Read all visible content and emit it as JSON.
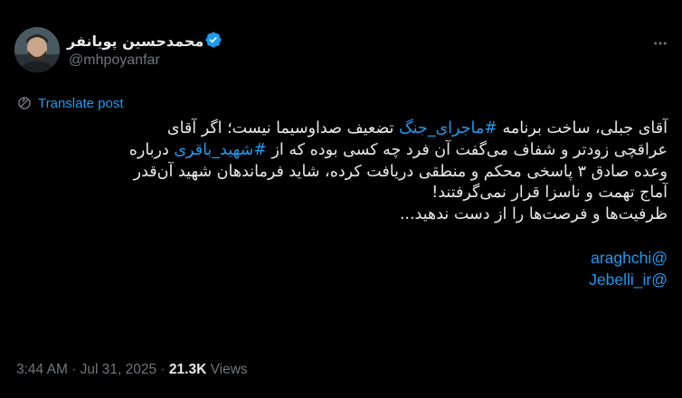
{
  "author": {
    "display_name": "محمدحسین پویانفر",
    "handle": "@mhpoyanfar",
    "verified_icon": "verified-badge-icon",
    "avatar_icon": "avatar"
  },
  "header": {
    "more_icon": "more-dots-icon"
  },
  "translate": {
    "label": "Translate post",
    "icon": "translate-icon"
  },
  "tweet": {
    "line1_before": "آقای جبلی، ساخت برنامه ",
    "hashtag1": "#ماجرای_جنگ",
    "line1_after": " تضعیف صداوسیما نیست؛ اگر آقای",
    "line2_before": "عراقچی زودتر و شفاف می‌گفت آن فرد چه کسی بوده که از ",
    "hashtag2": "#شهید_باقری",
    "line2_after": " درباره",
    "line3": "وعده صادق ۳ پاسخی محکم و منطقی دریافت کرده، شاید فرماندهان شهید آن‌قدر",
    "line4": "آماج تهمت و ناسزا قرار نمی‌گرفتند!",
    "line5": "ظرفیت‌ها و فرصت‌ها را از دست ندهید...",
    "mention1": "@araghchi",
    "mention2": "@Jebelli_ir"
  },
  "meta": {
    "time": "3:44 AM",
    "separator1": " · ",
    "date": "Jul 31, 2025",
    "separator2": " · ",
    "views_count": "21.3K",
    "views_label": " Views"
  },
  "colors": {
    "background": "#000000",
    "text": "#e7e9ea",
    "secondary": "#71767b",
    "accent": "#1d9bf0"
  }
}
